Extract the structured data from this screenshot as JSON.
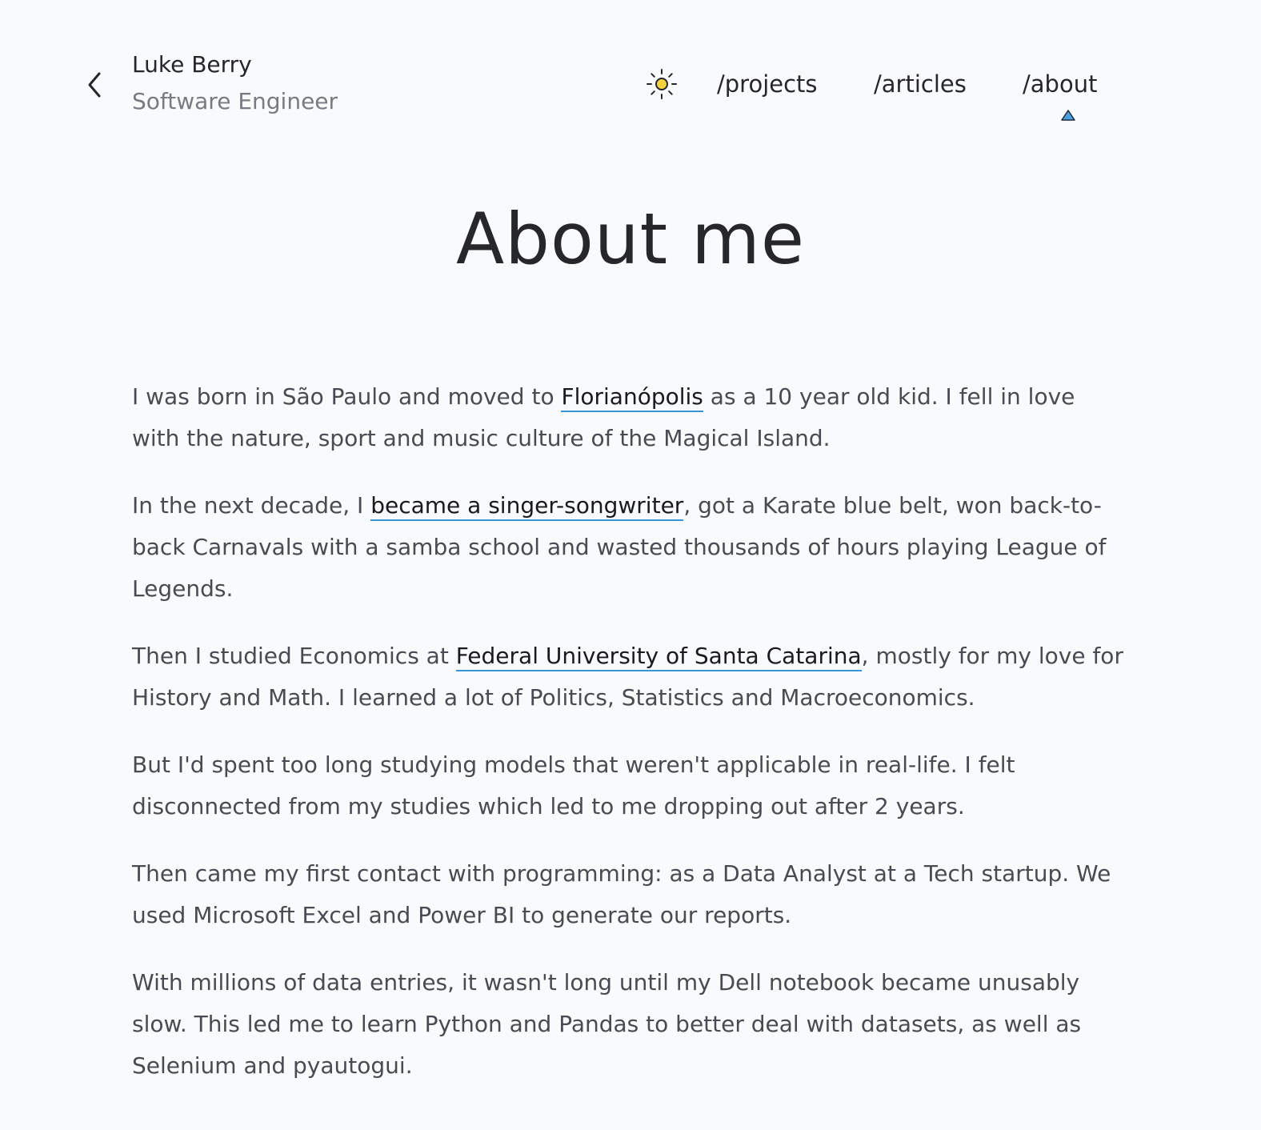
{
  "header": {
    "name": "Luke Berry",
    "role": "Software Engineer",
    "back_icon": "chevron-left-icon",
    "theme_icon": "sun-icon"
  },
  "nav": {
    "items": [
      {
        "label": "/projects"
      },
      {
        "label": "/articles"
      },
      {
        "label": "/about",
        "active": true
      }
    ],
    "active_marker_icon": "triangle-up-icon"
  },
  "page": {
    "title": "About me"
  },
  "paragraphs": [
    {
      "before": "I was born in São Paulo and moved to ",
      "link": "Florianópolis",
      "after": " as a 10 year old kid. I fell in love with the nature, sport and music culture of the Magical Island."
    },
    {
      "before": "In the next decade, I ",
      "link": "became a singer-songwriter",
      "after": ", got a Karate blue belt, won back-to-back Carnavals with a samba school and wasted thousands of hours playing League of Legends."
    },
    {
      "before": "Then I studied Economics at ",
      "link": "Federal University of Santa Catarina",
      "after": ", mostly for my love for History and Math. I learned a lot of Politics, Statistics and Macroeconomics."
    },
    {
      "text": "But I'd spent too long studying models that weren't applicable in real-life. I felt disconnected from my studies which led to me dropping out after 2 years."
    },
    {
      "text": "Then came my first contact with programming: as a Data Analyst at a Tech startup. We used Microsoft Excel and Power BI to generate our reports."
    },
    {
      "text": "With millions of data entries, it wasn't long until my Dell notebook became unusably slow. This led me to learn Python and Pandas to better deal with datasets, as well as Selenium and pyautogui."
    }
  ],
  "colors": {
    "background": "#f9fafb",
    "link_underline": "#3a95d8",
    "sun_fill": "#f5d33b",
    "active_marker": "#4a9fe0"
  }
}
